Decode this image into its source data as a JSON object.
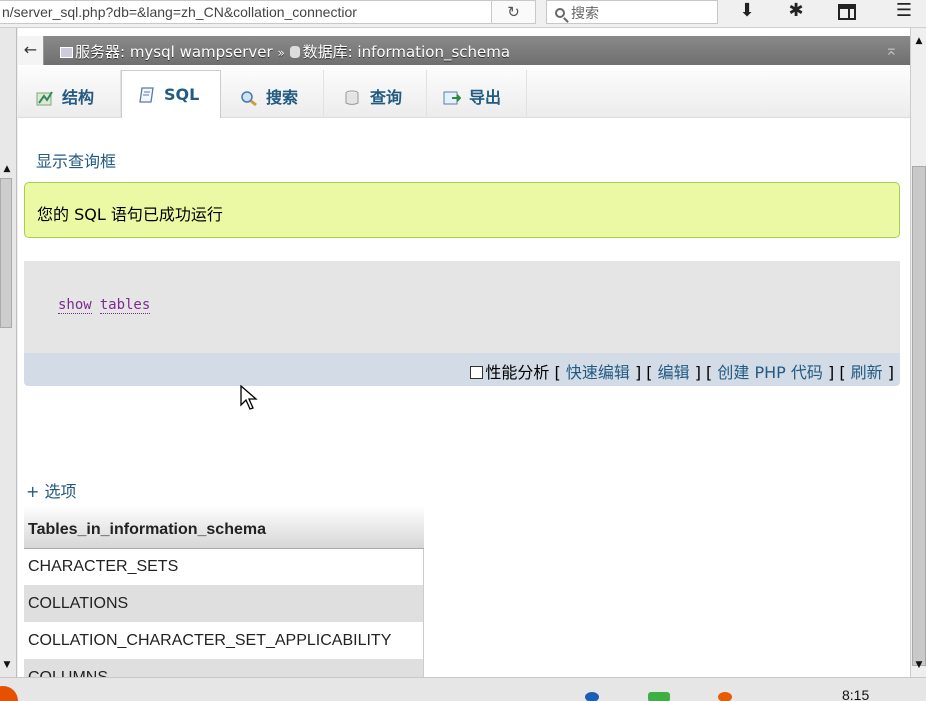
{
  "browser": {
    "url": "n/server_sql.php?db=&lang=zh_CN&collation_connectior",
    "search_placeholder": "搜索",
    "icons": [
      "reload-icon",
      "download-icon",
      "gear-icon",
      "window-icon",
      "menu-icon"
    ]
  },
  "breadcrumb": {
    "server_label": "服务器: mysql wampserver",
    "separator": "»",
    "db_label": "数据库: information_schema"
  },
  "tabs": [
    {
      "label": "结构",
      "icon": "structure-icon",
      "active": false
    },
    {
      "label": "SQL",
      "icon": "sql-icon",
      "active": true
    },
    {
      "label": "搜索",
      "icon": "search-icon",
      "active": false
    },
    {
      "label": "查询",
      "icon": "query-icon",
      "active": false
    },
    {
      "label": "导出",
      "icon": "export-icon",
      "active": false
    }
  ],
  "main": {
    "show_query_link": "显示查询框",
    "success_message": "您的 SQL 语句已成功运行",
    "sql_keyword_1": "show",
    "sql_keyword_2": "tables",
    "actions": {
      "profiling": "性能分析",
      "inline_edit": "快速编辑",
      "edit": "编辑",
      "create_php": "创建 PHP 代码",
      "refresh": "刷新"
    },
    "options_link": "+ 选项"
  },
  "table": {
    "header": "Tables_in_information_schema",
    "rows": [
      "CHARACTER_SETS",
      "COLLATIONS",
      "COLLATION_CHARACTER_SET_APPLICABILITY",
      "COLUMNS"
    ]
  },
  "taskbar": {
    "time": "8:15"
  },
  "colors": {
    "link": "#235a81",
    "success_bg": "#ebf8a4",
    "success_border": "#a2d246",
    "sql_keyword": "#7b2b8f"
  }
}
